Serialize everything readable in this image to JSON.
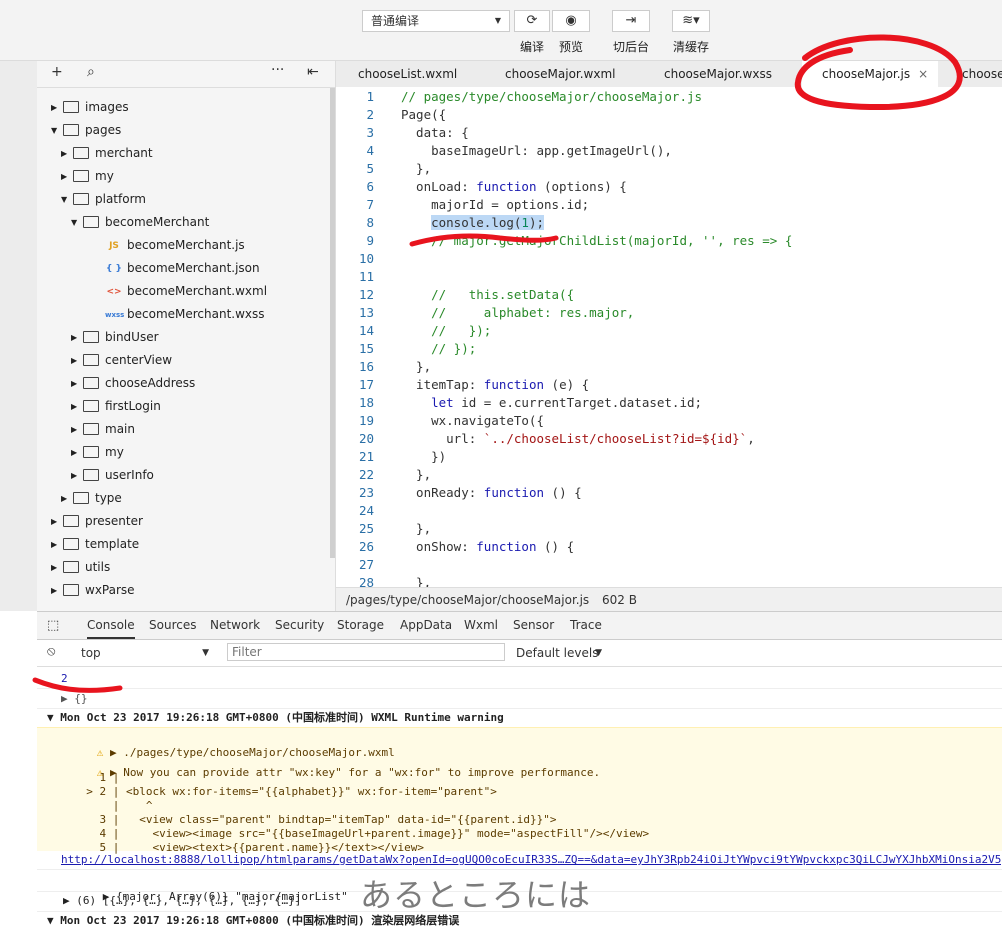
{
  "toolbar": {
    "compile_mode": "普通编译",
    "buttons": [
      {
        "label": "编译",
        "icon": "refresh-icon"
      },
      {
        "label": "预览",
        "icon": "eye-icon"
      },
      {
        "label": "切后台",
        "icon": "switch-icon"
      },
      {
        "label": "清缓存",
        "icon": "layers-icon"
      }
    ]
  },
  "tree": {
    "items": [
      {
        "label": "images",
        "type": "folder",
        "expanded": false
      },
      {
        "label": "pages",
        "type": "folder",
        "expanded": true
      },
      {
        "label": "merchant",
        "type": "folder",
        "expanded": false
      },
      {
        "label": "my",
        "type": "folder",
        "expanded": false
      },
      {
        "label": "platform",
        "type": "folder",
        "expanded": true
      },
      {
        "label": "becomeMerchant",
        "type": "folder",
        "expanded": true
      },
      {
        "label": "becomeMerchant.js",
        "type": "file",
        "badge": "JS"
      },
      {
        "label": "becomeMerchant.json",
        "type": "file",
        "badge": "{ }"
      },
      {
        "label": "becomeMerchant.wxml",
        "type": "file",
        "badge": "<>"
      },
      {
        "label": "becomeMerchant.wxss",
        "type": "file",
        "badge": "wxss"
      },
      {
        "label": "bindUser",
        "type": "folder",
        "expanded": false
      },
      {
        "label": "centerView",
        "type": "folder",
        "expanded": false
      },
      {
        "label": "chooseAddress",
        "type": "folder",
        "expanded": false
      },
      {
        "label": "firstLogin",
        "type": "folder",
        "expanded": false
      },
      {
        "label": "main",
        "type": "folder",
        "expanded": false
      },
      {
        "label": "my",
        "type": "folder",
        "expanded": false
      },
      {
        "label": "userInfo",
        "type": "folder",
        "expanded": false
      },
      {
        "label": "type",
        "type": "folder",
        "expanded": false
      },
      {
        "label": "presenter",
        "type": "folder",
        "expanded": false
      },
      {
        "label": "template",
        "type": "folder",
        "expanded": false
      },
      {
        "label": "utils",
        "type": "folder",
        "expanded": false
      },
      {
        "label": "wxParse",
        "type": "folder",
        "expanded": false
      }
    ]
  },
  "tabs": [
    {
      "label": "chooseList.wxml",
      "active": false
    },
    {
      "label": "chooseMajor.wxml",
      "active": false
    },
    {
      "label": "chooseMajor.wxss",
      "active": false
    },
    {
      "label": "chooseMajor.js",
      "active": true,
      "close": "×"
    },
    {
      "label": "choose",
      "active": false
    }
  ],
  "editor": {
    "lines": [
      "// pages/type/chooseMajor/chooseMajor.js",
      "Page({",
      "  data: {",
      "    baseImageUrl: app.getImageUrl(),",
      "  },",
      "  onLoad: function (options) {",
      "    majorId = options.id;",
      "    console.log(1);",
      "    // major.getMajorChildList(majorId, '', res => {",
      "",
      "",
      "    //   this.setData({",
      "    //     alphabet: res.major,",
      "    //   });",
      "    // });",
      "  },",
      "  itemTap: function (e) {",
      "    let id = e.currentTarget.dataset.id;",
      "    wx.navigateTo({",
      "      url: `../chooseList/chooseList?id=${id}`,",
      "    })",
      "  },",
      "  onReady: function () {",
      "",
      "  },",
      "  onShow: function () {",
      "",
      "  },"
    ]
  },
  "status": {
    "path": "/pages/type/chooseMajor/chooseMajor.js",
    "size": "602 B"
  },
  "devtools": {
    "tabs": [
      "Console",
      "Sources",
      "Network",
      "Security",
      "Storage",
      "AppData",
      "Wxml",
      "Sensor",
      "Trace"
    ],
    "active_tab": "Console",
    "context": "top",
    "filter_placeholder": "Filter",
    "levels": "Default levels",
    "console": {
      "value_line": "2",
      "object_line": "▶ {}",
      "warn_header": "▼ Mon Oct 23 2017 19:26:18 GMT+0800 (中国标准时间) WXML Runtime warning",
      "warn_file": "▶ ./pages/type/chooseMajor/chooseMajor.wxml",
      "warn_msg": "▶ Now you can provide attr \"wx:key\" for a \"wx:for\" to improve performance.",
      "code_lines": [
        "    1 |",
        "  > 2 | <block wx:for-items=\"{{alphabet}}\" wx:for-item=\"parent\">",
        "      |    ^",
        "    3 |   <view class=\"parent\" bindtap=\"itemTap\" data-id=\"{{parent.id}}\">",
        "    4 |     <view><image src=\"{{baseImageUrl+parent.image}}\" mode=\"aspectFill\"/></view>",
        "    5 |     <view><text>{{parent.name}}</text></view>"
      ],
      "url_line": "http://localhost:8888/lollipop/htmlparams/getDataWx?openId=ogUQO0coEcuIR33S…ZQ==&data=eyJhY3Rpb24iOiJtYWpvci9tYWpvckxpc3QiLCJwYXJhbXMiOnsia2V5I",
      "major_line": "▶ {major: Array(6)} \"major/majorList\"",
      "array_line": "▶ (6) [{…}, {…}, {…}, {…}, {…}, {…}]",
      "last_header": "▼ Mon Oct 23 2017 19:26:18 GMT+0800 (中国标准时间) 渲染层网络层错误"
    }
  },
  "watermark": "あるところには",
  "colors": {
    "annotation": "#e8141e",
    "comment": "#2a8a2a",
    "keyword": "#1a1ab0",
    "string": "#a31515",
    "selection": "#bcd8f5"
  }
}
